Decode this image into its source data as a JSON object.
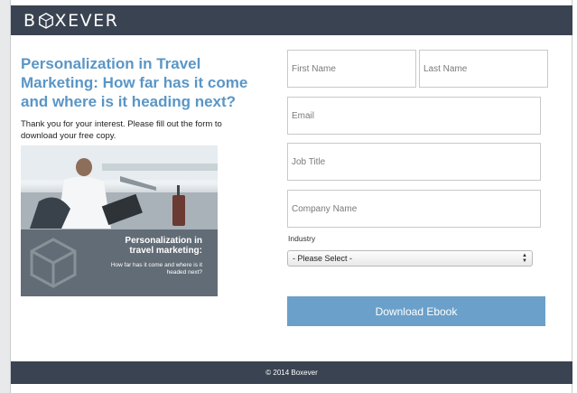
{
  "header": {
    "logo_text_1": "B",
    "logo_text_2": "XEVER"
  },
  "main": {
    "headline": "Personalization in Travel Marketing: How far has it come and where is it heading next?",
    "intro": "Thank you for your interest. Please fill out the form to download your free copy.",
    "cover": {
      "title": "Personalization in travel marketing:",
      "subtitle": "How far has it come and where is it headed next?"
    }
  },
  "form": {
    "first_name": {
      "placeholder": "First Name"
    },
    "last_name": {
      "placeholder": "Last Name"
    },
    "email": {
      "placeholder": "Email"
    },
    "job_title": {
      "placeholder": "Job Title"
    },
    "company": {
      "placeholder": "Company Name"
    },
    "industry_label": "Industry",
    "industry_selected": "- Please Select -",
    "submit_label": "Download Ebook"
  },
  "footer": {
    "text": "© 2014 Boxever"
  },
  "colors": {
    "header_bg": "#3a4351",
    "accent": "#5a96c6",
    "button": "#6aa0c9"
  }
}
